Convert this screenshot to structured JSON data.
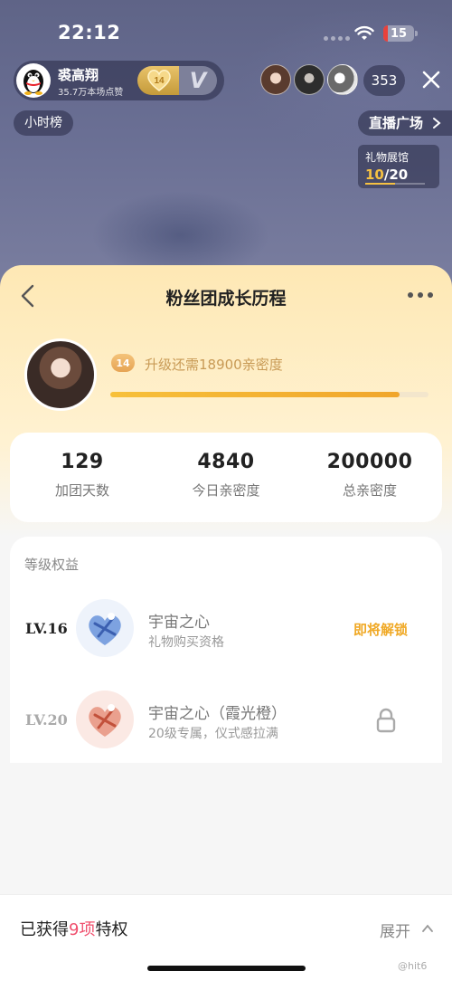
{
  "status": {
    "time": "22:12",
    "battery": "15",
    "battery_level": 0.15
  },
  "host": {
    "name": "裘高翔",
    "likes": "35.7万本场点赞",
    "fan_level": "14",
    "v_badge": "V"
  },
  "viewers": {
    "count": "353"
  },
  "left_tag": "小时榜",
  "live_square": "直播广场",
  "gift_hall": {
    "title": "礼物展馆",
    "current": "10",
    "total": "/20",
    "progress": 0.5
  },
  "sheet": {
    "title": "粉丝团成长历程",
    "level": "14",
    "upgrade_text": "升级还需18900亲密度",
    "upgrade_progress": 0.91
  },
  "stats": [
    {
      "value": "129",
      "label": "加团天数"
    },
    {
      "value": "4840",
      "label": "今日亲密度"
    },
    {
      "value": "200000",
      "label": "总亲密度"
    }
  ],
  "benefits": {
    "header": "等级权益",
    "items": [
      {
        "level": "LV.16",
        "name": "宇宙之心",
        "desc": "礼物购买资格",
        "status": "即将解锁",
        "locked": false,
        "level_color": "#222222"
      },
      {
        "level": "LV.20",
        "name": "宇宙之心（霞光橙）",
        "desc": "20级专属，仪式感拉满",
        "status": "",
        "locked": true,
        "level_color": "#aaaaaa"
      }
    ]
  },
  "footer": {
    "privilege_prefix": "已获得",
    "privilege_count": "9项",
    "privilege_suffix": "特权",
    "expand": "展开",
    "watermark": "@hit6"
  },
  "colors": {
    "accent_gold": "#f0a926",
    "highlight_red": "#f0506e"
  }
}
